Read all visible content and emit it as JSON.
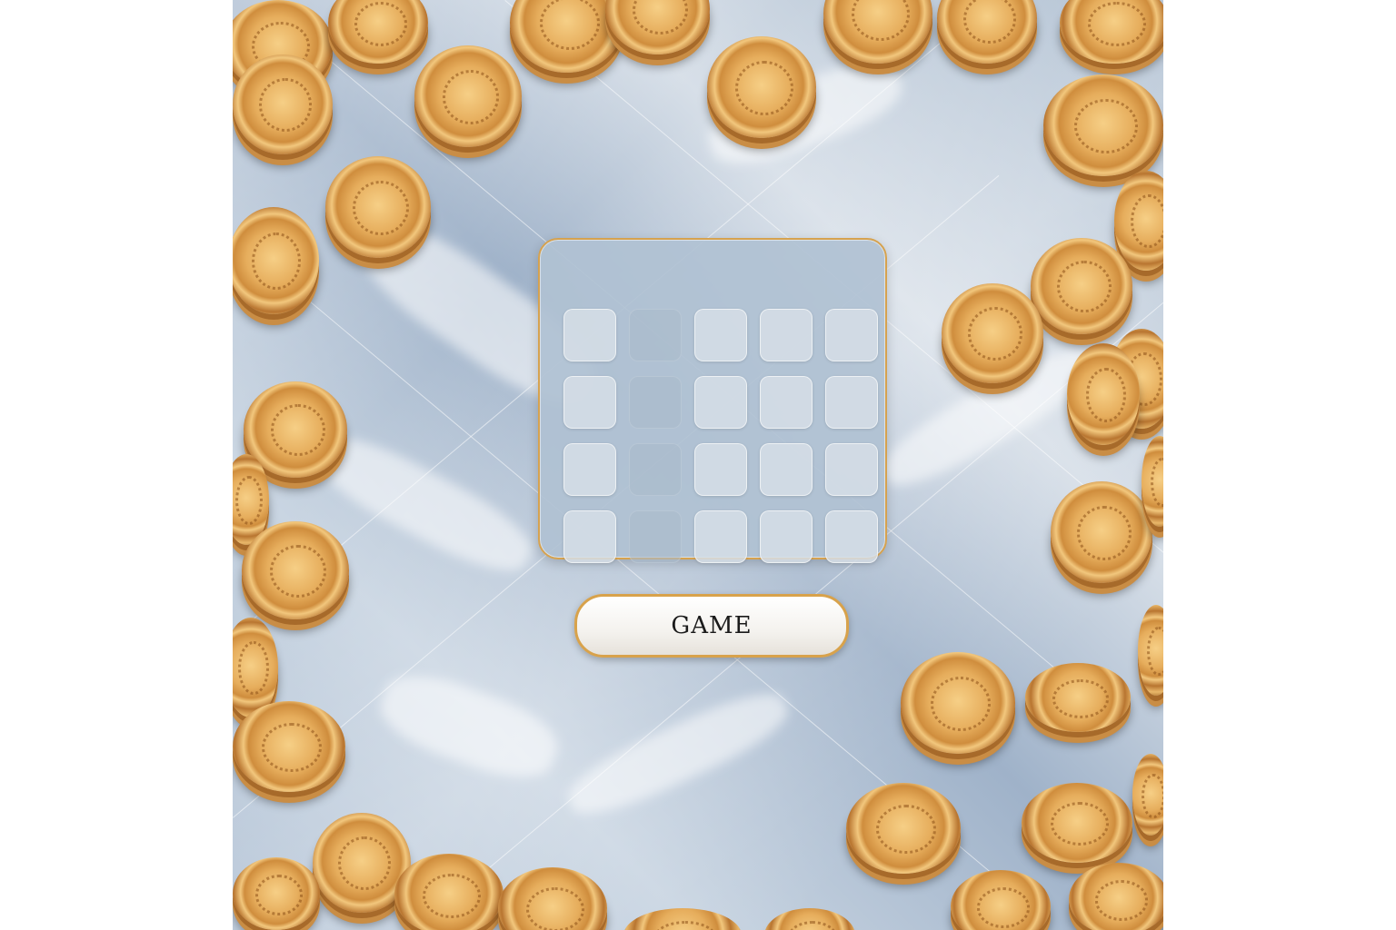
{
  "game": {
    "start_button_label": "GAME",
    "grid": {
      "rows": 4,
      "cols": 5,
      "empty_cells": [
        [
          0,
          1
        ],
        [
          1,
          1
        ],
        [
          2,
          1
        ],
        [
          3,
          1
        ]
      ]
    }
  },
  "theme": {
    "border_gold": "#d8a24b",
    "board_blue": "#b0c1d2",
    "tile_color": "#d6dee6",
    "coin_gold": "#e6ad5c"
  }
}
